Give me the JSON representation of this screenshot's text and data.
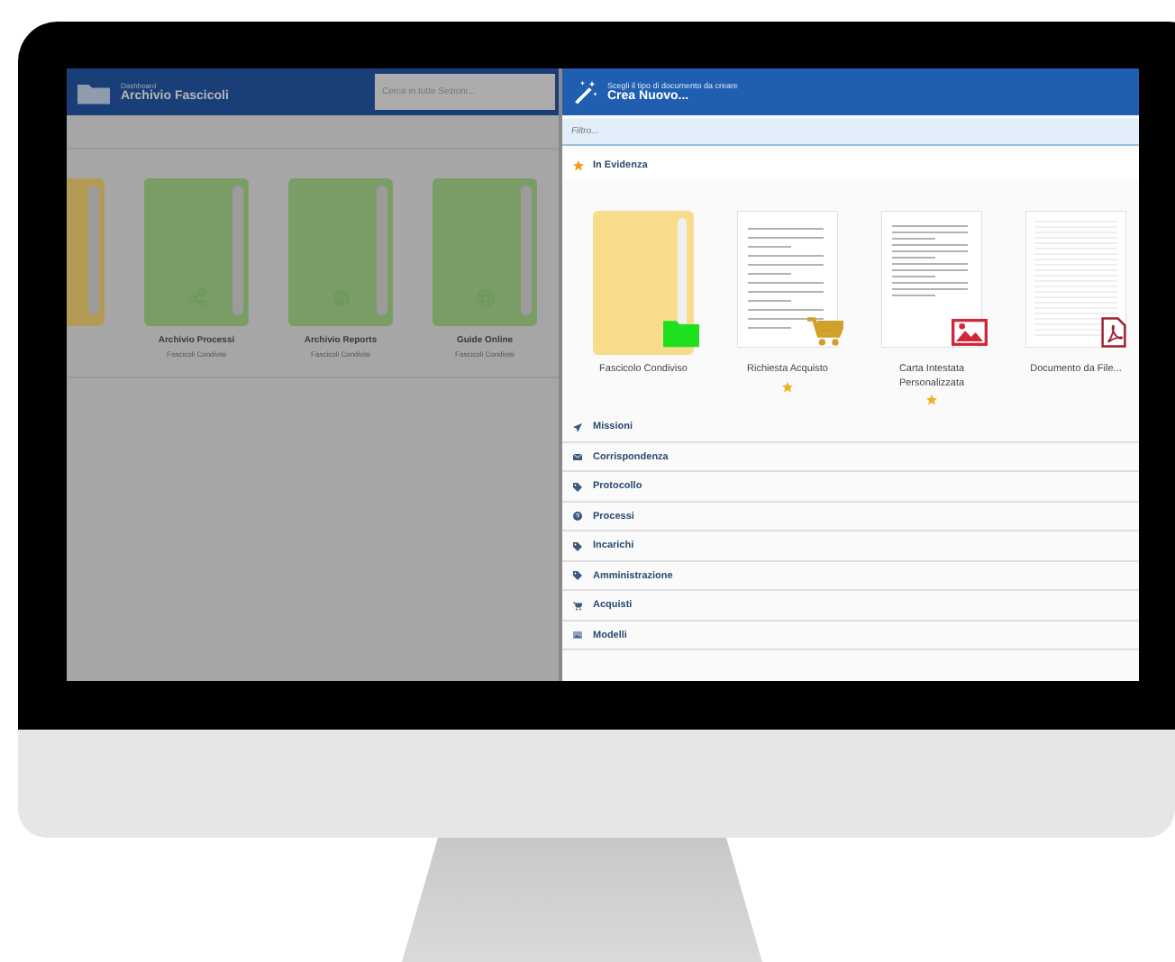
{
  "left_pane": {
    "header": {
      "subtitle": "Dashboard",
      "title": "Archivio Fascicoli"
    },
    "search": {
      "placeholder": "Cerca in tutte Sezioni..."
    },
    "cards": [
      {
        "color": "#b39b55",
        "kind": "plain"
      },
      {
        "color": "#7a9d65",
        "kind": "share",
        "title": "Archivio Processi",
        "subtitle": "Fascicoli Condivisi"
      },
      {
        "color": "#7a9d65",
        "kind": "globe",
        "title": "Archivio Reports",
        "subtitle": "Fascicoli Condivisi"
      },
      {
        "color": "#7a9d65",
        "kind": "lifebuoy",
        "title": "Guide Online",
        "subtitle": "Fascicoli Condivisi"
      }
    ]
  },
  "dialog": {
    "header": {
      "subtitle": "Scegli il tipo di documento da creare",
      "title": "Crea Nuovo..."
    },
    "filter": {
      "placeholder": "Filtro..."
    },
    "featured": {
      "title": "In Evidenza",
      "tiles": [
        {
          "kind": "folder",
          "label": "Fascicolo Condiviso",
          "starred": false
        },
        {
          "kind": "purchase",
          "label": "Richiesta Acquisto",
          "starred": true
        },
        {
          "kind": "letterhead",
          "label": "Carta Intestata Personalizzata",
          "starred": true
        },
        {
          "kind": "pdf",
          "label": "Documento da File...",
          "starred": false
        }
      ]
    },
    "categories": [
      {
        "kind": "send",
        "label": "Missioni"
      },
      {
        "kind": "mail",
        "label": "Corrispondenza"
      },
      {
        "kind": "tag",
        "label": "Protocollo"
      },
      {
        "kind": "help",
        "label": "Processi"
      },
      {
        "kind": "tag",
        "label": "Incarichi"
      },
      {
        "kind": "tag",
        "label": "Amministrazione"
      },
      {
        "kind": "cart",
        "label": "Acquisti"
      },
      {
        "kind": "picture",
        "label": "Modelli"
      }
    ]
  }
}
